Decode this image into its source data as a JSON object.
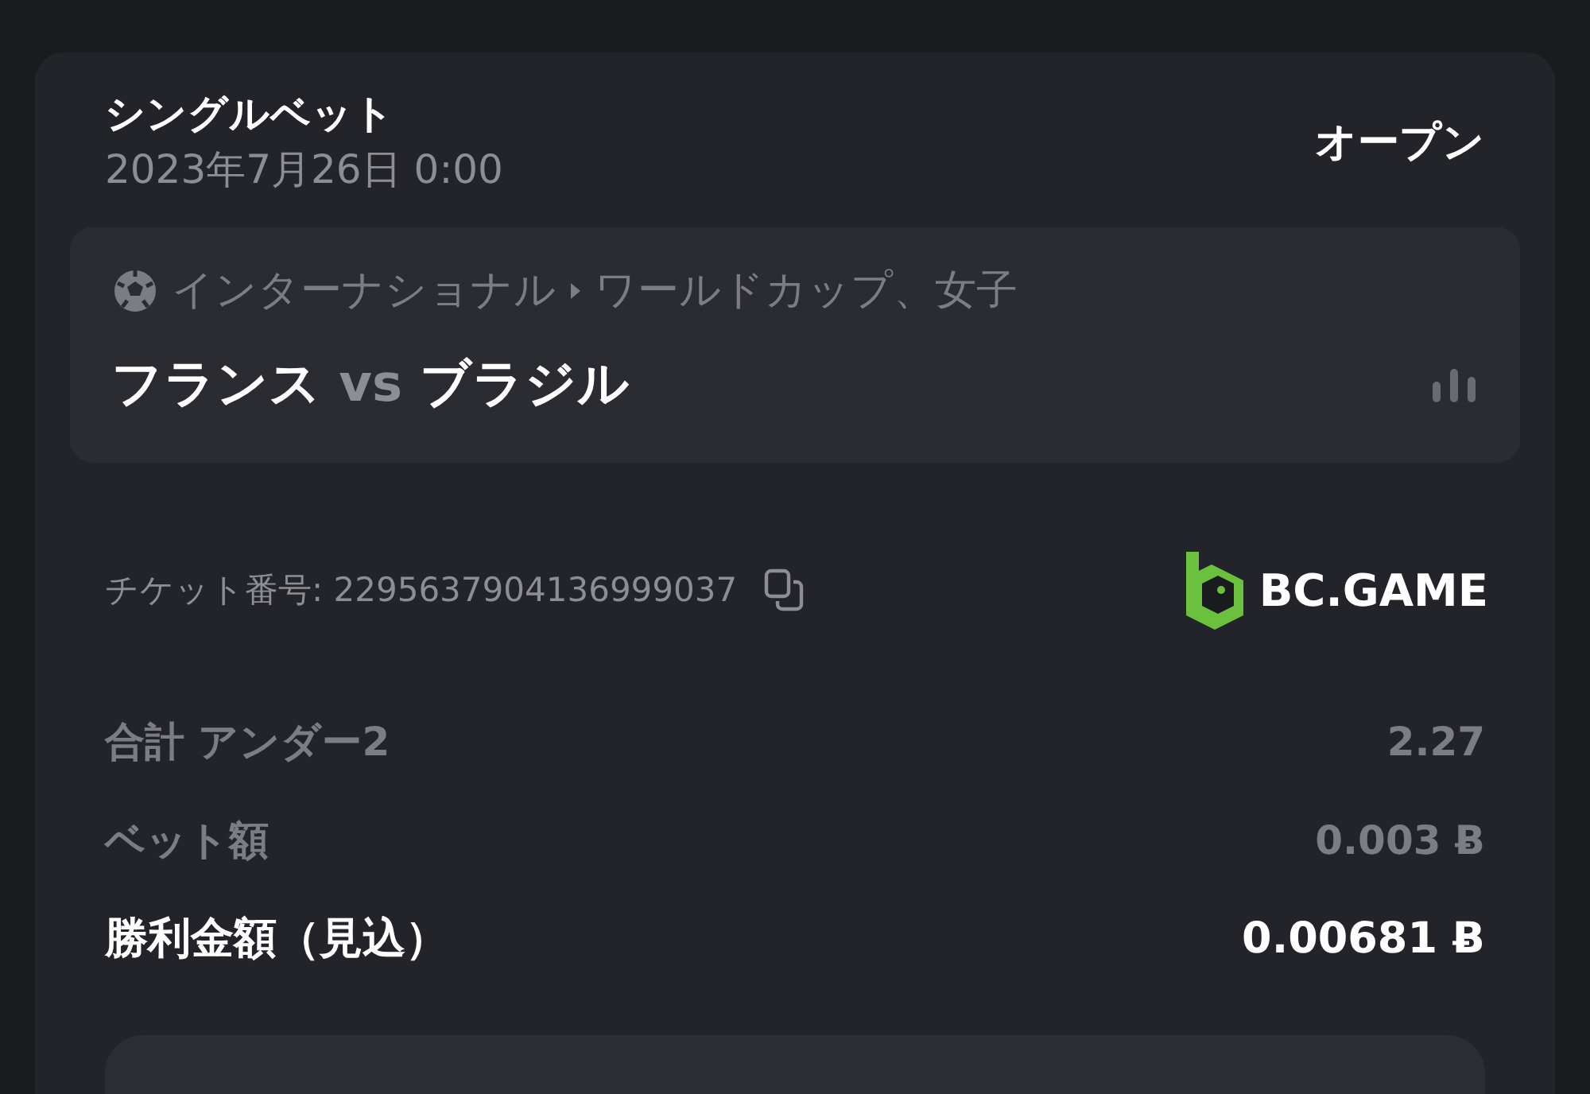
{
  "bet": {
    "type": "シングルベット",
    "date": "2023年7月26日 0:00",
    "status": "オープン"
  },
  "event": {
    "category": "インターナショナル",
    "league": "ワールドカップ、女子",
    "home": "フランス",
    "vs": "vs",
    "away": "ブラジル"
  },
  "ticket": {
    "label": "チケット番号: 2295637904136999037",
    "brand": "BC.GAME"
  },
  "summary": [
    {
      "kind": "muted",
      "label": "合計 アンダー2",
      "value": "2.27"
    },
    {
      "kind": "muted",
      "label": "ベット額",
      "value": "0.003 Ƀ"
    },
    {
      "kind": "total",
      "label": "勝利金額（見込）",
      "value": "0.00681 Ƀ"
    }
  ]
}
